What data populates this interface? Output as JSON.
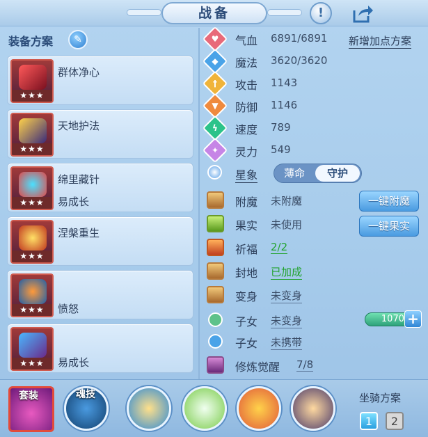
{
  "header": {
    "title": "战备",
    "info_label": "!"
  },
  "equip_plan": {
    "title": "装备方案",
    "items": [
      {
        "name": "群体净心",
        "sub": "",
        "stars": "★★★"
      },
      {
        "name": "天地护法",
        "sub": "",
        "stars": "★★★"
      },
      {
        "name": "绵里藏针",
        "sub": "易成长",
        "stars": "★★★"
      },
      {
        "name": "涅槃重生",
        "sub": "",
        "stars": "★★★"
      },
      {
        "name": "",
        "sub": "愤怒",
        "stars": "★★★"
      },
      {
        "name": "",
        "sub": "易成长",
        "stars": "★★★"
      }
    ]
  },
  "stats": {
    "add_points_link": "新增加点方案",
    "items": [
      {
        "label": "气血",
        "value": "6891/6891",
        "color": "#e86a7a"
      },
      {
        "label": "魔法",
        "value": "3620/3620",
        "color": "#4aa3e8"
      },
      {
        "label": "攻击",
        "value": "1143",
        "color": "#f0b43a"
      },
      {
        "label": "防御",
        "value": "1146",
        "color": "#ef8a3e"
      },
      {
        "label": "速度",
        "value": "789",
        "color": "#2cc38a"
      },
      {
        "label": "灵力",
        "value": "549",
        "color": "#c685e6"
      }
    ],
    "star_sign": {
      "label": "星象",
      "opt_a": "薄命",
      "opt_b": "守护"
    }
  },
  "extras": {
    "enchant": {
      "label": "附魔",
      "value": "未附魔",
      "button": "一键附魔"
    },
    "fruit": {
      "label": "果实",
      "value": "未使用",
      "button": "一键果实"
    },
    "prayer": {
      "label": "祈福",
      "value": "2/2"
    },
    "seal": {
      "label": "封地",
      "value": "已加成"
    },
    "transform": {
      "label": "变身",
      "value": "未变身"
    },
    "child1": {
      "label": "子女",
      "value": "未变身",
      "counter": "1070",
      "plus": "+"
    },
    "child2": {
      "label": "子女",
      "value": "未携带"
    },
    "cultivation": {
      "label": "修炼觉醒",
      "value": "7/8"
    }
  },
  "bottom": {
    "set_label": "套装",
    "soul_label": "魂技",
    "mount_title": "坐骑方案",
    "mount_1": "1",
    "mount_2": "2"
  }
}
